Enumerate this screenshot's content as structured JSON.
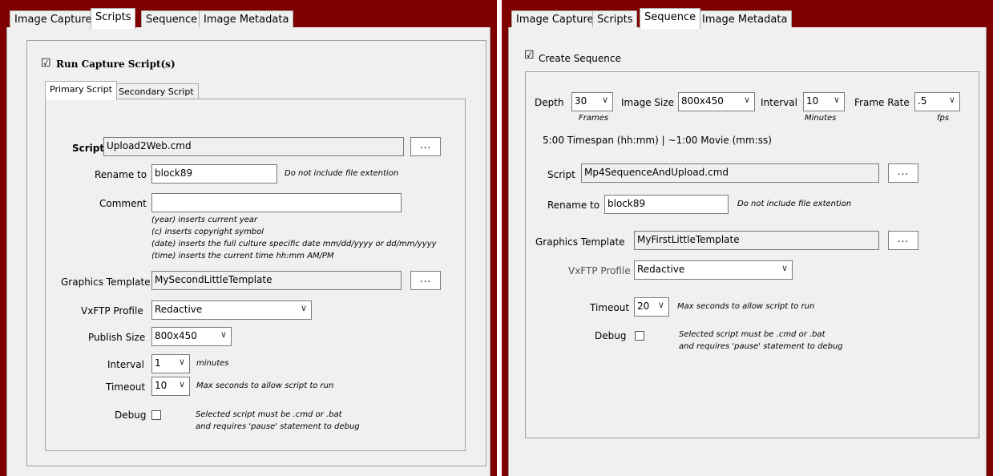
{
  "left": {
    "tabs": [
      "Image Capture",
      "Scripts",
      "Sequence",
      "Image Metadata"
    ],
    "active_tab": "Scripts",
    "run_capture_label": "Run Capture Script(s)",
    "run_capture_checked": "☑",
    "subtabs": [
      "Primary Script",
      "Secondary Script"
    ],
    "script_label": "Script",
    "script_value": "Upload2Web.cmd",
    "browse": "...",
    "rename_label": "Rename to",
    "rename_value": "block89",
    "rename_hint": "Do not include file extention",
    "comment_label": "Comment",
    "comment_value": "",
    "comment_hints": [
      "(year) inserts current year",
      "(c) inserts copyright symbol",
      "(date) inserts the full culture specific date mm/dd/yyyy or dd/mm/yyyy",
      "(time) inserts the current time hh:mm AM/PM"
    ],
    "template_label": "Graphics Template",
    "template_value": "MySecondLittleTemplate",
    "vxftp_label": "VxFTP Profile",
    "vxftp_value": "Redactive",
    "publish_label": "Publish Size",
    "publish_value": "800x450",
    "interval_label": "Interval",
    "interval_value": "1",
    "interval_hint": "minutes",
    "timeout_label": "Timeout",
    "timeout_value": "10",
    "timeout_hint": "Max seconds to allow script to run",
    "debug_label": "Debug",
    "debug_hint1": "Selected script must be .cmd or .bat",
    "debug_hint2": "and requires 'pause' statement to debug"
  },
  "right": {
    "tabs": [
      "Image Capture",
      "Scripts",
      "Sequence",
      "Image Metadata"
    ],
    "active_tab": "Sequence",
    "create_label": "Create Sequence",
    "create_checked": "☑",
    "depth_label": "Depth",
    "depth_value": "30",
    "depth_unit": "Frames",
    "size_label": "Image Size",
    "size_value": "800x450",
    "interval_label": "Interval",
    "interval_value": "10",
    "interval_unit": "Minutes",
    "rate_label": "Frame Rate",
    "rate_value": ".5",
    "rate_unit": "fps",
    "timespan": "5:00 Timespan (hh:mm) | ~1:00 Movie (mm:ss)",
    "script_label": "Script",
    "script_value": "Mp4SequenceAndUpload.cmd",
    "browse": "...",
    "rename_label": "Rename to",
    "rename_value": "block89",
    "rename_hint": "Do not include file extention",
    "template_label": "Graphics Template",
    "template_value": "MyFirstLittleTemplate",
    "vxftp_label": "VxFTP Profile",
    "vxftp_value": "Redactive",
    "timeout_label": "Timeout",
    "timeout_value": "20",
    "timeout_hint": "Max seconds to allow script to run",
    "debug_label": "Debug",
    "debug_hint1": "Selected script must be .cmd or .bat",
    "debug_hint2": "and requires 'pause' statement to debug"
  },
  "colors": {
    "frame": "#800000",
    "panel": "#f0f0f0"
  }
}
